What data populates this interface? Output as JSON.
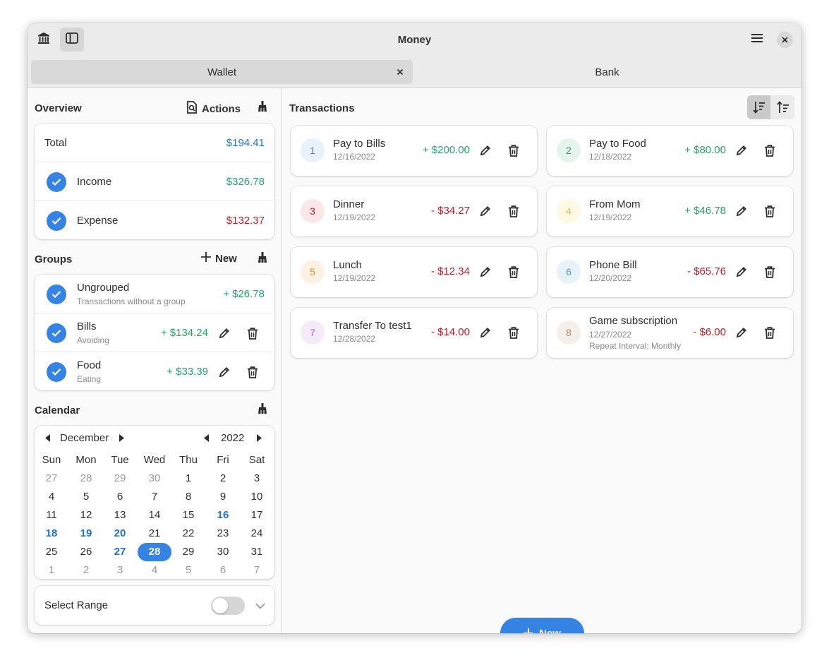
{
  "window": {
    "title": "Money"
  },
  "tabs": [
    {
      "label": "Wallet",
      "selected": true
    },
    {
      "label": "Bank",
      "selected": false
    }
  ],
  "overview": {
    "title": "Overview",
    "actions_label": "Actions",
    "total_label": "Total",
    "total_value": "$194.41",
    "income_label": "Income",
    "income_value": "$326.78",
    "expense_label": "Expense",
    "expense_value": "$132.37"
  },
  "groups": {
    "title": "Groups",
    "new_label": "New",
    "items": [
      {
        "name": "Ungrouped",
        "desc": "Transactions without a group",
        "amount": "+  $26.78"
      },
      {
        "name": "Bills",
        "desc": "Avoiding",
        "amount": "+  $134.24"
      },
      {
        "name": "Food",
        "desc": "Eating",
        "amount": "+  $33.39"
      }
    ]
  },
  "calendar": {
    "title": "Calendar",
    "month": "December",
    "year": "2022",
    "weekdays": [
      "Sun",
      "Mon",
      "Tue",
      "Wed",
      "Thu",
      "Fri",
      "Sat"
    ],
    "weeks": [
      [
        "27",
        "28",
        "29",
        "30",
        "1",
        "2",
        "3"
      ],
      [
        "4",
        "5",
        "6",
        "7",
        "8",
        "9",
        "10"
      ],
      [
        "11",
        "12",
        "13",
        "14",
        "15",
        "16",
        "17"
      ],
      [
        "18",
        "19",
        "20",
        "21",
        "22",
        "23",
        "24"
      ],
      [
        "25",
        "26",
        "27",
        "28",
        "29",
        "30",
        "31"
      ],
      [
        "1",
        "2",
        "3",
        "4",
        "5",
        "6",
        "7"
      ]
    ],
    "select_range_label": "Select Range"
  },
  "transactions": {
    "title": "Transactions",
    "new_label": "New",
    "items": [
      {
        "id": "1",
        "name": "Pay to Bills",
        "date": "12/16/2022",
        "amount": "+  $200.00",
        "type": "income",
        "color": "#3584e4",
        "bg": "#e8f1fc"
      },
      {
        "id": "2",
        "name": "Pay to Food",
        "date": "12/18/2022",
        "amount": "+  $80.00",
        "type": "income",
        "color": "#26a269",
        "bg": "#e6f5ec"
      },
      {
        "id": "3",
        "name": "Dinner",
        "date": "12/19/2022",
        "amount": "-  $34.27",
        "type": "expense",
        "color": "#c01c28",
        "bg": "#fbe6e8"
      },
      {
        "id": "4",
        "name": "From Mom",
        "date": "12/19/2022",
        "amount": "+  $46.78",
        "type": "income",
        "color": "#e5c42a",
        "bg": "#fdf9e3"
      },
      {
        "id": "5",
        "name": "Lunch",
        "date": "12/19/2022",
        "amount": "-  $12.34",
        "type": "expense",
        "color": "#e5892e",
        "bg": "#fdf1e4"
      },
      {
        "id": "6",
        "name": "Phone Bill",
        "date": "12/20/2022",
        "amount": "-  $65.76",
        "type": "expense",
        "color": "#4a9bd1",
        "bg": "#e8f2f9"
      },
      {
        "id": "7",
        "name": "Transfer To test1",
        "date": "12/28/2022",
        "amount": "-  $14.00",
        "type": "expense",
        "color": "#b35ec9",
        "bg": "#f5eaf8"
      },
      {
        "id": "8",
        "name": "Game subscription",
        "date": "12/27/2022",
        "repeat": "Repeat Interval: Monthly",
        "amount": "-  $6.00",
        "type": "expense",
        "color": "#b08a6a",
        "bg": "#f5efe9"
      }
    ]
  }
}
